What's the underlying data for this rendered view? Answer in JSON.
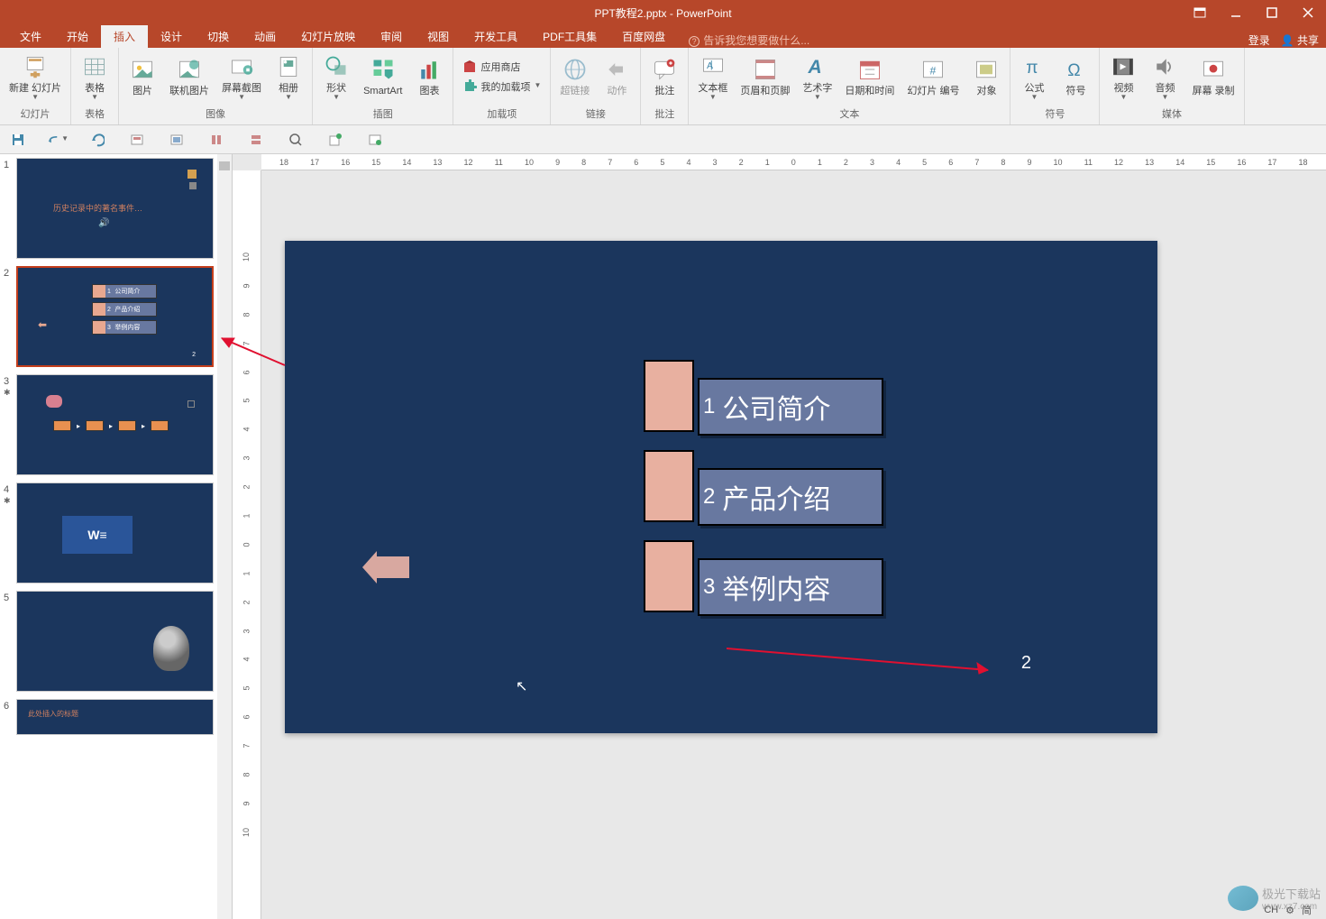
{
  "titlebar": {
    "title": "PPT教程2.pptx - PowerPoint"
  },
  "menu": {
    "tabs": [
      "文件",
      "开始",
      "插入",
      "设计",
      "切换",
      "动画",
      "幻灯片放映",
      "审阅",
      "视图",
      "开发工具",
      "PDF工具集",
      "百度网盘"
    ],
    "active": 2,
    "tellme": "告诉我您想要做什么...",
    "login": "登录",
    "share": "共享"
  },
  "ribbon": {
    "groups": {
      "slides": {
        "label": "幻灯片",
        "newslide": "新建\n幻灯片"
      },
      "tables": {
        "label": "表格",
        "table": "表格"
      },
      "images": {
        "label": "图像",
        "picture": "图片",
        "online": "联机图片",
        "screenshot": "屏幕截图",
        "album": "相册"
      },
      "illust": {
        "label": "插图",
        "shapes": "形状",
        "smartart": "SmartArt",
        "chart": "图表"
      },
      "addins": {
        "label": "加载项",
        "store": "应用商店",
        "myaddins": "我的加载项"
      },
      "links": {
        "label": "链接",
        "hyperlink": "超链接",
        "action": "动作"
      },
      "comments": {
        "label": "批注",
        "comment": "批注"
      },
      "text": {
        "label": "文本",
        "textbox": "文本框",
        "headerfooter": "页眉和页脚",
        "wordart": "艺术字",
        "datetime": "日期和时间",
        "slidenum": "幻灯片\n编号",
        "object": "对象"
      },
      "symbols": {
        "label": "符号",
        "equation": "公式",
        "symbol": "符号"
      },
      "media": {
        "label": "媒体",
        "video": "视频",
        "audio": "音频",
        "screenrec": "屏幕\n录制"
      }
    }
  },
  "ruler_h": [
    "18",
    "17",
    "16",
    "15",
    "14",
    "13",
    "12",
    "11",
    "10",
    "9",
    "8",
    "7",
    "6",
    "5",
    "4",
    "3",
    "2",
    "1",
    "0",
    "1",
    "2",
    "3",
    "4",
    "5",
    "6",
    "7",
    "8",
    "9",
    "10",
    "11",
    "12",
    "13",
    "14",
    "15",
    "16",
    "17",
    "18"
  ],
  "ruler_v": [
    "10",
    "9",
    "8",
    "7",
    "6",
    "5",
    "4",
    "3",
    "2",
    "1",
    "0",
    "1",
    "2",
    "3",
    "4",
    "5",
    "6",
    "7",
    "8",
    "9",
    "10"
  ],
  "slides": {
    "s1": {
      "num": "1",
      "title": "历史记录中的著名事件…"
    },
    "s2": {
      "num": "2",
      "r1": "公司简介",
      "r2": "产品介绍",
      "r3": "举例内容",
      "page": "2",
      "n1": "1",
      "n2": "2",
      "n3": "3"
    },
    "s3": {
      "num": "3"
    },
    "s4": {
      "num": "4"
    },
    "s5": {
      "num": "5"
    },
    "s6": {
      "num": "6",
      "title": "此处插入的标题"
    }
  },
  "canvas": {
    "row1": {
      "num": "1",
      "txt": "公司简介"
    },
    "row2": {
      "num": "2",
      "txt": "产品介绍"
    },
    "row3": {
      "num": "3",
      "txt": "举例内容"
    },
    "page": "2"
  },
  "status": {
    "ime": "CH",
    "lang": "简"
  },
  "watermark": {
    "txt": "极光下载站",
    "url": "www.xz7.com"
  }
}
